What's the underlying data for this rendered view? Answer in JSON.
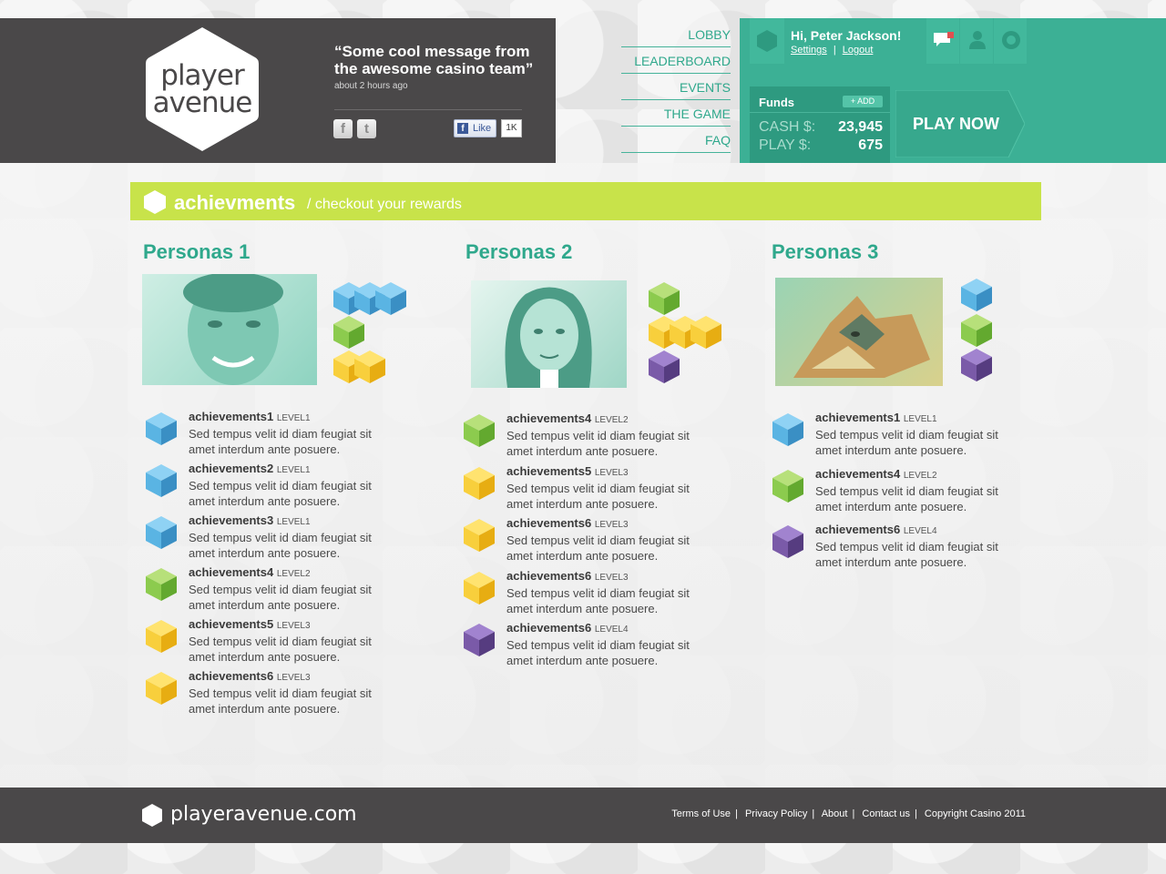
{
  "brand": {
    "logo_line1": "player",
    "logo_line2": "avenue",
    "domain": "playeravenue.com"
  },
  "header": {
    "quote": "“Some cool message from the awesome casino team”",
    "quote_time": "about 2 hours ago",
    "social": {
      "facebook_icon": "f",
      "twitter_icon": "t",
      "like_label": "Like",
      "like_count": "1K"
    }
  },
  "nav": [
    "LOBBY",
    "LEADERBOARD",
    "EVENTS",
    "THE GAME",
    "FAQ"
  ],
  "account": {
    "greeting": "Hi, Peter Jackson!",
    "settings": "Settings",
    "separator": "|",
    "logout": "Logout",
    "funds_title": "Funds",
    "add_label": "+ ADD",
    "cash_label": "CASH $:",
    "cash_value": "23,945",
    "play_label": "PLAY $:",
    "play_value": "675",
    "play_now": "PLAY NOW"
  },
  "section": {
    "title": "achievments",
    "subtitle": "/ checkout your rewards"
  },
  "colors": {
    "blue": "#5ab4e3",
    "green": "#8ccb4e",
    "yellow": "#f8cf3c",
    "purple": "#7a5aa8",
    "teal": "#3cb095",
    "lime": "#c8e34a",
    "dark": "#4a4849"
  },
  "personas": [
    {
      "title": "Personas 1",
      "photo": "man-portrait-image",
      "achievements": [
        {
          "name": "achievements1",
          "level": "LEVEL1",
          "desc": "Sed tempus velit id diam feugiat sit amet interdum ante posuere.",
          "color": "blue"
        },
        {
          "name": "achievements2",
          "level": "LEVEL1",
          "desc": "Sed tempus velit id diam feugiat sit amet interdum ante posuere.",
          "color": "blue"
        },
        {
          "name": "achievements3",
          "level": "LEVEL1",
          "desc": "Sed tempus velit id diam feugiat sit amet interdum ante posuere.",
          "color": "blue"
        },
        {
          "name": "achievements4",
          "level": "LEVEL2",
          "desc": "Sed tempus velit id diam feugiat sit amet interdum ante posuere.",
          "color": "green"
        },
        {
          "name": "achievements5",
          "level": "LEVEL3",
          "desc": "Sed tempus velit id diam feugiat sit amet interdum ante posuere.",
          "color": "yellow"
        },
        {
          "name": "achievements6",
          "level": "LEVEL3",
          "desc": "Sed tempus velit id diam feugiat sit amet interdum ante posuere.",
          "color": "yellow"
        }
      ]
    },
    {
      "title": "Personas 2",
      "photo": "woman-portrait-image",
      "achievements": [
        {
          "name": "achievements4",
          "level": "LEVEL2",
          "desc": "Sed tempus velit id diam feugiat sit amet interdum ante posuere.",
          "color": "green"
        },
        {
          "name": "achievements5",
          "level": "LEVEL3",
          "desc": "Sed tempus velit id diam feugiat sit amet interdum ante posuere.",
          "color": "yellow"
        },
        {
          "name": "achievements6",
          "level": "LEVEL3",
          "desc": "Sed tempus velit id diam feugiat sit amet interdum ante posuere.",
          "color": "yellow"
        },
        {
          "name": "achievements6",
          "level": "LEVEL3",
          "desc": "Sed tempus velit id diam feugiat sit amet interdum ante posuere.",
          "color": "yellow"
        },
        {
          "name": "achievements6",
          "level": "LEVEL4",
          "desc": "Sed tempus velit id diam feugiat sit amet interdum ante posuere.",
          "color": "purple"
        }
      ]
    },
    {
      "title": "Personas 3",
      "photo": "wolf-image",
      "achievements": [
        {
          "name": "achievements1",
          "level": "LEVEL1",
          "desc": "Sed tempus velit id diam feugiat sit amet interdum ante posuere.",
          "color": "blue"
        },
        {
          "name": "achievements4",
          "level": "LEVEL2",
          "desc": "Sed tempus velit id diam feugiat sit amet interdum ante posuere.",
          "color": "green"
        },
        {
          "name": "achievements6",
          "level": "LEVEL4",
          "desc": "Sed tempus velit id diam feugiat sit amet interdum ante posuere.",
          "color": "purple"
        }
      ]
    }
  ],
  "footer": {
    "links": [
      "Terms of Use",
      "Privacy Policy",
      "About",
      "Contact us",
      "Copyright Casino 2011"
    ]
  }
}
